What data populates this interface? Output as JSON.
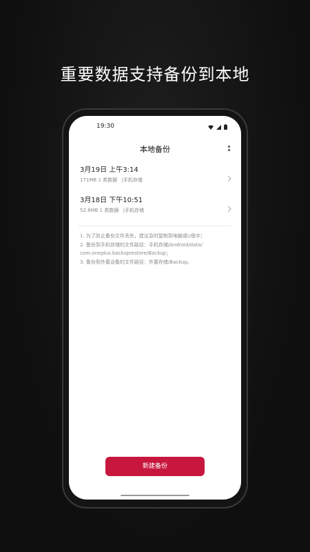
{
  "promo": {
    "headline": "重要数据支持备份到本地"
  },
  "status_bar": {
    "time": "19:30",
    "icons": [
      "wifi-icon",
      "signal-icon",
      "battery-icon"
    ]
  },
  "app_bar": {
    "title": "本地备份",
    "more_icon": "more-vert-icon"
  },
  "backups": [
    {
      "title": "3月19日 上午3:14",
      "size": "171MB",
      "types": "1 类数据",
      "location": "|手机存储"
    },
    {
      "title": "3月18日 下午10:51",
      "size": "52.6MB",
      "types": "1 类数据",
      "location": "|手机存储"
    }
  ],
  "notes": [
    "1. 为了防止备份文件丢失，建议及时复制到电脑或U盘中；",
    "2. 备份到手机存储的文件路径：手机存储/Android/data/",
    "com.oneplus.backuprestore/Backup；",
    "3. 备份到外置设备的文件路径：外置存储/Backup。"
  ],
  "actions": {
    "new_backup_label": "新建备份"
  },
  "colors": {
    "accent": "#c8173e",
    "background": "#0d0d0d",
    "screen": "#ffffff"
  }
}
